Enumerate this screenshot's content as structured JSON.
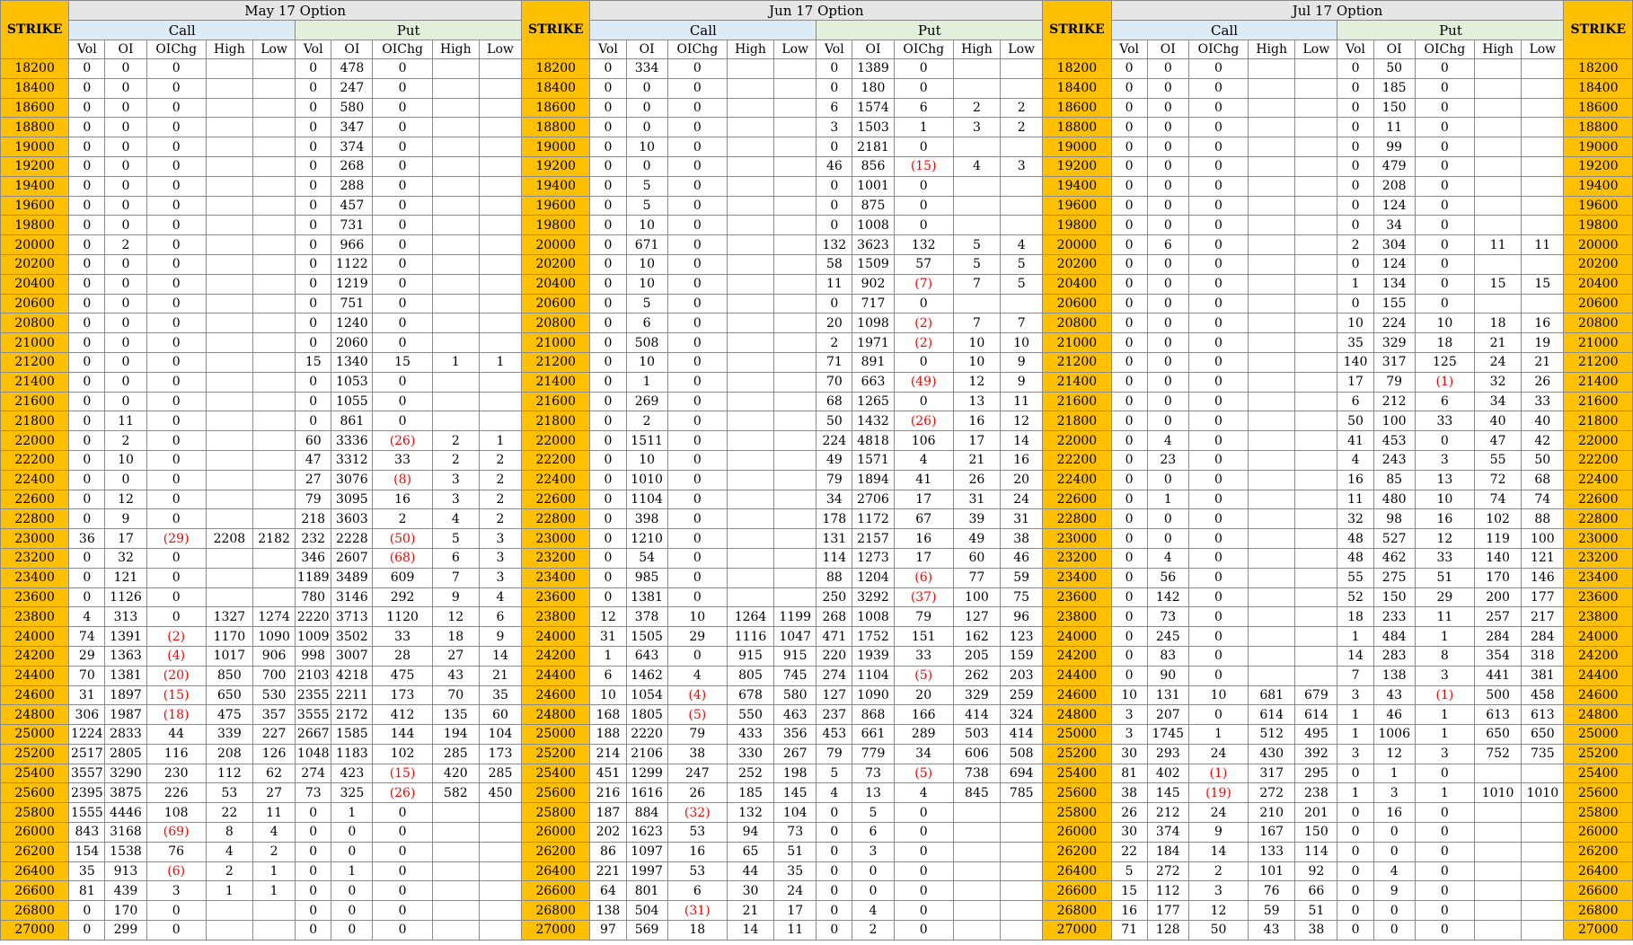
{
  "strike_label": "STRIKE",
  "call_label": "Call",
  "put_label": "Put",
  "sub_columns": [
    "Vol",
    "OI",
    "OIChg",
    "High",
    "Low"
  ],
  "months": [
    "May 17 Option",
    "Jun 17 Option",
    "Jul 17 Option"
  ],
  "rows": [
    [
      "18200",
      "0",
      "0",
      "0",
      "",
      "",
      "0",
      "478",
      "0",
      "",
      "",
      "0",
      "334",
      "0",
      "",
      "",
      "0",
      "1389",
      "0",
      "",
      "",
      "0",
      "0",
      "0",
      "",
      "",
      "0",
      "50",
      "0",
      "",
      ""
    ],
    [
      "18400",
      "0",
      "0",
      "0",
      "",
      "",
      "0",
      "247",
      "0",
      "",
      "",
      "0",
      "0",
      "0",
      "",
      "",
      "0",
      "180",
      "0",
      "",
      "",
      "0",
      "0",
      "0",
      "",
      "",
      "0",
      "185",
      "0",
      "",
      ""
    ],
    [
      "18600",
      "0",
      "0",
      "0",
      "",
      "",
      "0",
      "580",
      "0",
      "",
      "",
      "0",
      "0",
      "0",
      "",
      "",
      "6",
      "1574",
      "6",
      "2",
      "2",
      "0",
      "0",
      "0",
      "",
      "",
      "0",
      "150",
      "0",
      "",
      ""
    ],
    [
      "18800",
      "0",
      "0",
      "0",
      "",
      "",
      "0",
      "347",
      "0",
      "",
      "",
      "0",
      "0",
      "0",
      "",
      "",
      "3",
      "1503",
      "1",
      "3",
      "2",
      "0",
      "0",
      "0",
      "",
      "",
      "0",
      "11",
      "0",
      "",
      ""
    ],
    [
      "19000",
      "0",
      "0",
      "0",
      "",
      "",
      "0",
      "374",
      "0",
      "",
      "",
      "0",
      "10",
      "0",
      "",
      "",
      "0",
      "2181",
      "0",
      "",
      "",
      "0",
      "0",
      "0",
      "",
      "",
      "0",
      "99",
      "0",
      "",
      ""
    ],
    [
      "19200",
      "0",
      "0",
      "0",
      "",
      "",
      "0",
      "268",
      "0",
      "",
      "",
      "0",
      "0",
      "0",
      "",
      "",
      "46",
      "856",
      "(15)",
      "4",
      "3",
      "0",
      "0",
      "0",
      "",
      "",
      "0",
      "479",
      "0",
      "",
      ""
    ],
    [
      "19400",
      "0",
      "0",
      "0",
      "",
      "",
      "0",
      "288",
      "0",
      "",
      "",
      "0",
      "5",
      "0",
      "",
      "",
      "0",
      "1001",
      "0",
      "",
      "",
      "0",
      "0",
      "0",
      "",
      "",
      "0",
      "208",
      "0",
      "",
      ""
    ],
    [
      "19600",
      "0",
      "0",
      "0",
      "",
      "",
      "0",
      "457",
      "0",
      "",
      "",
      "0",
      "5",
      "0",
      "",
      "",
      "0",
      "875",
      "0",
      "",
      "",
      "0",
      "0",
      "0",
      "",
      "",
      "0",
      "124",
      "0",
      "",
      ""
    ],
    [
      "19800",
      "0",
      "0",
      "0",
      "",
      "",
      "0",
      "731",
      "0",
      "",
      "",
      "0",
      "10",
      "0",
      "",
      "",
      "0",
      "1008",
      "0",
      "",
      "",
      "0",
      "0",
      "0",
      "",
      "",
      "0",
      "34",
      "0",
      "",
      ""
    ],
    [
      "20000",
      "0",
      "2",
      "0",
      "",
      "",
      "0",
      "966",
      "0",
      "",
      "",
      "0",
      "671",
      "0",
      "",
      "",
      "132",
      "3623",
      "132",
      "5",
      "4",
      "0",
      "6",
      "0",
      "",
      "",
      "2",
      "304",
      "0",
      "11",
      "11"
    ],
    [
      "20200",
      "0",
      "0",
      "0",
      "",
      "",
      "0",
      "1122",
      "0",
      "",
      "",
      "0",
      "10",
      "0",
      "",
      "",
      "58",
      "1509",
      "57",
      "5",
      "5",
      "0",
      "0",
      "0",
      "",
      "",
      "0",
      "124",
      "0",
      "",
      ""
    ],
    [
      "20400",
      "0",
      "0",
      "0",
      "",
      "",
      "0",
      "1219",
      "0",
      "",
      "",
      "0",
      "10",
      "0",
      "",
      "",
      "11",
      "902",
      "(7)",
      "7",
      "5",
      "0",
      "0",
      "0",
      "",
      "",
      "1",
      "134",
      "0",
      "15",
      "15"
    ],
    [
      "20600",
      "0",
      "0",
      "0",
      "",
      "",
      "0",
      "751",
      "0",
      "",
      "",
      "0",
      "5",
      "0",
      "",
      "",
      "0",
      "717",
      "0",
      "",
      "",
      "0",
      "0",
      "0",
      "",
      "",
      "0",
      "155",
      "0",
      "",
      ""
    ],
    [
      "20800",
      "0",
      "0",
      "0",
      "",
      "",
      "0",
      "1240",
      "0",
      "",
      "",
      "0",
      "6",
      "0",
      "",
      "",
      "20",
      "1098",
      "(2)",
      "7",
      "7",
      "0",
      "0",
      "0",
      "",
      "",
      "10",
      "224",
      "10",
      "18",
      "16"
    ],
    [
      "21000",
      "0",
      "0",
      "0",
      "",
      "",
      "0",
      "2060",
      "0",
      "",
      "",
      "0",
      "508",
      "0",
      "",
      "",
      "2",
      "1971",
      "(2)",
      "10",
      "10",
      "0",
      "0",
      "0",
      "",
      "",
      "35",
      "329",
      "18",
      "21",
      "19"
    ],
    [
      "21200",
      "0",
      "0",
      "0",
      "",
      "",
      "15",
      "1340",
      "15",
      "1",
      "1",
      "0",
      "10",
      "0",
      "",
      "",
      "71",
      "891",
      "0",
      "10",
      "9",
      "0",
      "0",
      "0",
      "",
      "",
      "140",
      "317",
      "125",
      "24",
      "21"
    ],
    [
      "21400",
      "0",
      "0",
      "0",
      "",
      "",
      "0",
      "1053",
      "0",
      "",
      "",
      "0",
      "1",
      "0",
      "",
      "",
      "70",
      "663",
      "(49)",
      "12",
      "9",
      "0",
      "0",
      "0",
      "",
      "",
      "17",
      "79",
      "(1)",
      "32",
      "26"
    ],
    [
      "21600",
      "0",
      "0",
      "0",
      "",
      "",
      "0",
      "1055",
      "0",
      "",
      "",
      "0",
      "269",
      "0",
      "",
      "",
      "68",
      "1265",
      "0",
      "13",
      "11",
      "0",
      "0",
      "0",
      "",
      "",
      "6",
      "212",
      "6",
      "34",
      "33"
    ],
    [
      "21800",
      "0",
      "11",
      "0",
      "",
      "",
      "0",
      "861",
      "0",
      "",
      "",
      "0",
      "2",
      "0",
      "",
      "",
      "50",
      "1432",
      "(26)",
      "16",
      "12",
      "0",
      "0",
      "0",
      "",
      "",
      "50",
      "100",
      "33",
      "40",
      "40"
    ],
    [
      "22000",
      "0",
      "2",
      "0",
      "",
      "",
      "60",
      "3336",
      "(26)",
      "2",
      "1",
      "0",
      "1511",
      "0",
      "",
      "",
      "224",
      "4818",
      "106",
      "17",
      "14",
      "0",
      "4",
      "0",
      "",
      "",
      "41",
      "453",
      "0",
      "47",
      "42"
    ],
    [
      "22200",
      "0",
      "10",
      "0",
      "",
      "",
      "47",
      "3312",
      "33",
      "2",
      "2",
      "0",
      "10",
      "0",
      "",
      "",
      "49",
      "1571",
      "4",
      "21",
      "16",
      "0",
      "23",
      "0",
      "",
      "",
      "4",
      "243",
      "3",
      "55",
      "50"
    ],
    [
      "22400",
      "0",
      "0",
      "0",
      "",
      "",
      "27",
      "3076",
      "(8)",
      "3",
      "2",
      "0",
      "1010",
      "0",
      "",
      "",
      "79",
      "1894",
      "41",
      "26",
      "20",
      "0",
      "0",
      "0",
      "",
      "",
      "16",
      "85",
      "13",
      "72",
      "68"
    ],
    [
      "22600",
      "0",
      "12",
      "0",
      "",
      "",
      "79",
      "3095",
      "16",
      "3",
      "2",
      "0",
      "1104",
      "0",
      "",
      "",
      "34",
      "2706",
      "17",
      "31",
      "24",
      "0",
      "1",
      "0",
      "",
      "",
      "11",
      "480",
      "10",
      "74",
      "74"
    ],
    [
      "22800",
      "0",
      "9",
      "0",
      "",
      "",
      "218",
      "3603",
      "2",
      "4",
      "2",
      "0",
      "398",
      "0",
      "",
      "",
      "178",
      "1172",
      "67",
      "39",
      "31",
      "0",
      "0",
      "0",
      "",
      "",
      "32",
      "98",
      "16",
      "102",
      "88"
    ],
    [
      "23000",
      "36",
      "17",
      "(29)",
      "2208",
      "2182",
      "232",
      "2228",
      "(50)",
      "5",
      "3",
      "0",
      "1210",
      "0",
      "",
      "",
      "131",
      "2157",
      "16",
      "49",
      "38",
      "0",
      "0",
      "0",
      "",
      "",
      "48",
      "527",
      "12",
      "119",
      "100"
    ],
    [
      "23200",
      "0",
      "32",
      "0",
      "",
      "",
      "346",
      "2607",
      "(68)",
      "6",
      "3",
      "0",
      "54",
      "0",
      "",
      "",
      "114",
      "1273",
      "17",
      "60",
      "46",
      "0",
      "4",
      "0",
      "",
      "",
      "48",
      "462",
      "33",
      "140",
      "121"
    ],
    [
      "23400",
      "0",
      "121",
      "0",
      "",
      "",
      "1189",
      "3489",
      "609",
      "7",
      "3",
      "0",
      "985",
      "0",
      "",
      "",
      "88",
      "1204",
      "(6)",
      "77",
      "59",
      "0",
      "56",
      "0",
      "",
      "",
      "55",
      "275",
      "51",
      "170",
      "146"
    ],
    [
      "23600",
      "0",
      "1126",
      "0",
      "",
      "",
      "780",
      "3146",
      "292",
      "9",
      "4",
      "0",
      "1381",
      "0",
      "",
      "",
      "250",
      "3292",
      "(37)",
      "100",
      "75",
      "0",
      "142",
      "0",
      "",
      "",
      "52",
      "150",
      "29",
      "200",
      "177"
    ],
    [
      "23800",
      "4",
      "313",
      "0",
      "1327",
      "1274",
      "2220",
      "3713",
      "1120",
      "12",
      "6",
      "12",
      "378",
      "10",
      "1264",
      "1199",
      "268",
      "1008",
      "79",
      "127",
      "96",
      "0",
      "73",
      "0",
      "",
      "",
      "18",
      "233",
      "11",
      "257",
      "217"
    ],
    [
      "24000",
      "74",
      "1391",
      "(2)",
      "1170",
      "1090",
      "1009",
      "3502",
      "33",
      "18",
      "9",
      "31",
      "1505",
      "29",
      "1116",
      "1047",
      "471",
      "1752",
      "151",
      "162",
      "123",
      "0",
      "245",
      "0",
      "",
      "",
      "1",
      "484",
      "1",
      "284",
      "284"
    ],
    [
      "24200",
      "29",
      "1363",
      "(4)",
      "1017",
      "906",
      "998",
      "3007",
      "28",
      "27",
      "14",
      "1",
      "643",
      "0",
      "915",
      "915",
      "220",
      "1939",
      "33",
      "205",
      "159",
      "0",
      "83",
      "0",
      "",
      "",
      "14",
      "283",
      "8",
      "354",
      "318"
    ],
    [
      "24400",
      "70",
      "1381",
      "(20)",
      "850",
      "700",
      "2103",
      "4218",
      "475",
      "43",
      "21",
      "6",
      "1462",
      "4",
      "805",
      "745",
      "274",
      "1104",
      "(5)",
      "262",
      "203",
      "0",
      "90",
      "0",
      "",
      "",
      "7",
      "138",
      "3",
      "441",
      "381"
    ],
    [
      "24600",
      "31",
      "1897",
      "(15)",
      "650",
      "530",
      "2355",
      "2211",
      "173",
      "70",
      "35",
      "10",
      "1054",
      "(4)",
      "678",
      "580",
      "127",
      "1090",
      "20",
      "329",
      "259",
      "10",
      "131",
      "10",
      "681",
      "679",
      "3",
      "43",
      "(1)",
      "500",
      "458"
    ],
    [
      "24800",
      "306",
      "1987",
      "(18)",
      "475",
      "357",
      "3555",
      "2172",
      "412",
      "135",
      "60",
      "168",
      "1805",
      "(5)",
      "550",
      "463",
      "237",
      "868",
      "166",
      "414",
      "324",
      "3",
      "207",
      "0",
      "614",
      "614",
      "1",
      "46",
      "1",
      "613",
      "613"
    ],
    [
      "25000",
      "1224",
      "2833",
      "44",
      "339",
      "227",
      "2667",
      "1585",
      "144",
      "194",
      "104",
      "188",
      "2220",
      "79",
      "433",
      "356",
      "453",
      "661",
      "289",
      "503",
      "414",
      "3",
      "1745",
      "1",
      "512",
      "495",
      "1",
      "1006",
      "1",
      "650",
      "650"
    ],
    [
      "25200",
      "2517",
      "2805",
      "116",
      "208",
      "126",
      "1048",
      "1183",
      "102",
      "285",
      "173",
      "214",
      "2106",
      "38",
      "330",
      "267",
      "79",
      "779",
      "34",
      "606",
      "508",
      "30",
      "293",
      "24",
      "430",
      "392",
      "3",
      "12",
      "3",
      "752",
      "735"
    ],
    [
      "25400",
      "3557",
      "3290",
      "230",
      "112",
      "62",
      "274",
      "423",
      "(15)",
      "420",
      "285",
      "451",
      "1299",
      "247",
      "252",
      "198",
      "5",
      "73",
      "(5)",
      "738",
      "694",
      "81",
      "402",
      "(1)",
      "317",
      "295",
      "0",
      "1",
      "0",
      "",
      ""
    ],
    [
      "25600",
      "2395",
      "3875",
      "226",
      "53",
      "27",
      "73",
      "325",
      "(26)",
      "582",
      "450",
      "216",
      "1616",
      "26",
      "185",
      "145",
      "4",
      "13",
      "4",
      "845",
      "785",
      "38",
      "145",
      "(19)",
      "272",
      "238",
      "1",
      "3",
      "1",
      "1010",
      "1010"
    ],
    [
      "25800",
      "1555",
      "4446",
      "108",
      "22",
      "11",
      "0",
      "1",
      "0",
      "",
      "",
      "187",
      "884",
      "(32)",
      "132",
      "104",
      "0",
      "5",
      "0",
      "",
      "",
      "26",
      "212",
      "24",
      "210",
      "201",
      "0",
      "16",
      "0",
      "",
      ""
    ],
    [
      "26000",
      "843",
      "3168",
      "(69)",
      "8",
      "4",
      "0",
      "0",
      "0",
      "",
      "",
      "202",
      "1623",
      "53",
      "94",
      "73",
      "0",
      "6",
      "0",
      "",
      "",
      "30",
      "374",
      "9",
      "167",
      "150",
      "0",
      "0",
      "0",
      "",
      ""
    ],
    [
      "26200",
      "154",
      "1538",
      "76",
      "4",
      "2",
      "0",
      "0",
      "0",
      "",
      "",
      "86",
      "1097",
      "16",
      "65",
      "51",
      "0",
      "3",
      "0",
      "",
      "",
      "22",
      "184",
      "14",
      "133",
      "114",
      "0",
      "0",
      "0",
      "",
      ""
    ],
    [
      "26400",
      "35",
      "913",
      "(6)",
      "2",
      "1",
      "0",
      "1",
      "0",
      "",
      "",
      "221",
      "1997",
      "53",
      "44",
      "35",
      "0",
      "0",
      "0",
      "",
      "",
      "5",
      "272",
      "2",
      "101",
      "92",
      "0",
      "4",
      "0",
      "",
      ""
    ],
    [
      "26600",
      "81",
      "439",
      "3",
      "1",
      "1",
      "0",
      "0",
      "0",
      "",
      "",
      "64",
      "801",
      "6",
      "30",
      "24",
      "0",
      "0",
      "0",
      "",
      "",
      "15",
      "112",
      "3",
      "76",
      "66",
      "0",
      "9",
      "0",
      "",
      ""
    ],
    [
      "26800",
      "0",
      "170",
      "0",
      "",
      "",
      "0",
      "0",
      "0",
      "",
      "",
      "138",
      "504",
      "(31)",
      "21",
      "17",
      "0",
      "4",
      "0",
      "",
      "",
      "16",
      "177",
      "12",
      "59",
      "51",
      "0",
      "0",
      "0",
      "",
      ""
    ],
    [
      "27000",
      "0",
      "299",
      "0",
      "",
      "",
      "0",
      "0",
      "0",
      "",
      "",
      "97",
      "569",
      "18",
      "14",
      "11",
      "0",
      "2",
      "0",
      "",
      "",
      "71",
      "128",
      "50",
      "43",
      "38",
      "0",
      "0",
      "0",
      "",
      ""
    ]
  ]
}
